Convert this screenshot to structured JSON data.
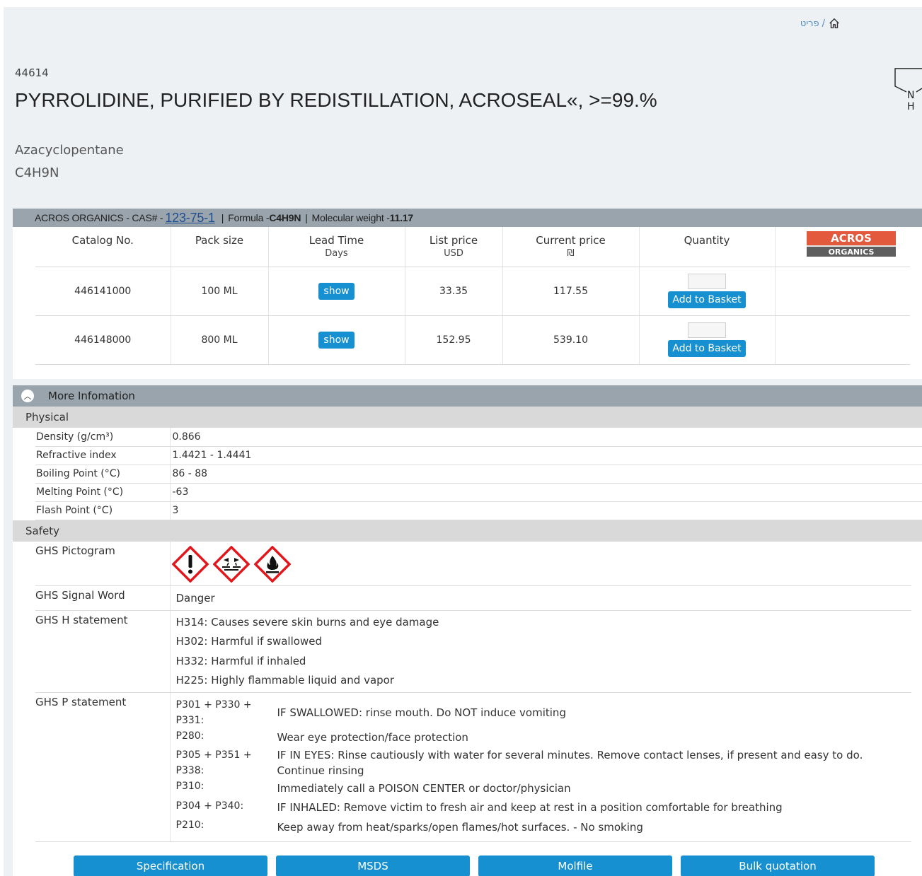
{
  "breadcrumb": {
    "current": "פריט",
    "separator": "/"
  },
  "product": {
    "catalog_number": "44614",
    "title": "PYRROLIDINE, PURIFIED BY REDISTILLATION, ACROSEAL«, >=99.%",
    "synonym": "Azacyclopentane",
    "formula": "C4H9N"
  },
  "structure_labels": {
    "n": "N",
    "h": "H"
  },
  "card": {
    "brand": "ACROS ORGANICS - CAS# - ",
    "cas": "123-75-1",
    "sep1": "|",
    "formula_label": "Formula - ",
    "formula_value": "C4H9N",
    "sep2": "|",
    "mw_label": "Molecular weight - ",
    "mw_value": "11.17",
    "columns": {
      "catalog": "Catalog No.",
      "pack": "Pack size",
      "lead": "Lead Time",
      "lead_sub": "Days",
      "list": "List price",
      "list_sub": "USD",
      "current": "Current price",
      "current_sub": "₪",
      "quantity": "Quantity"
    },
    "logo": {
      "top": "ACROS",
      "bottom": "ORGANICS"
    },
    "rows": [
      {
        "catalog": "446141000",
        "pack": "100 ML",
        "lead": "show",
        "list": "33.35",
        "current": "117.55",
        "add": "Add to Basket"
      },
      {
        "catalog": "446148000",
        "pack": "800 ML",
        "lead": "show",
        "list": "152.95",
        "current": "539.10",
        "add": "Add to Basket"
      }
    ]
  },
  "more_info": {
    "title": "More Infomation",
    "physical_title": "Physical",
    "physical": [
      {
        "k": "Density (g/cm³)",
        "v": "0.866"
      },
      {
        "k": "Refractive index",
        "v": "1.4421 - 1.4441"
      },
      {
        "k": "Boiling Point (°C)",
        "v": "86 - 88"
      },
      {
        "k": "Melting Point (°C)",
        "v": "-63"
      },
      {
        "k": "Flash Point (°C)",
        "v": "3"
      }
    ],
    "safety_title": "Safety",
    "ghs_pictogram_label": "GHS Pictogram",
    "pictograms": [
      "exclamation-pictogram",
      "corrosion-pictogram",
      "flame-pictogram"
    ],
    "ghs_signal_label": "GHS Signal Word",
    "signal_word": "Danger",
    "ghs_h_label": "GHS H statement",
    "h_statements": [
      "H314: Causes severe skin burns and eye damage",
      "H302: Harmful if swallowed",
      "H332: Harmful if inhaled",
      "H225: Highly flammable liquid and vapor"
    ],
    "ghs_p_label": "GHS P statement",
    "p_statements": [
      {
        "code": "P301 + P330 + P331:",
        "text": "IF SWALLOWED: rinse mouth. Do NOT induce vomiting"
      },
      {
        "code": "P280:",
        "text": "Wear eye protection/face protection"
      },
      {
        "code": "P305 + P351 + P338:",
        "text": "IF IN EYES: Rinse cautiously with water for several minutes. Remove contact lenses, if present and easy to do. Continue rinsing"
      },
      {
        "code": "P310:",
        "text": "Immediately call a POISON CENTER or doctor/physician"
      },
      {
        "code": "P304 + P340:",
        "text": "IF INHALED: Remove victim to fresh air and keep at rest in a position comfortable for breathing"
      },
      {
        "code": "P210:",
        "text": "Keep away from heat/sparks/open flames/hot surfaces. - No smoking"
      }
    ]
  },
  "footer_buttons": {
    "specification": "Specification",
    "msds": "MSDS",
    "molfile": "Molfile",
    "bulk": "Bulk quotation"
  },
  "colors": {
    "accent": "#1690d0",
    "header_bar": "#9aa4ac",
    "ghs_red": "#e3161b",
    "logo_red": "#e2593d"
  }
}
